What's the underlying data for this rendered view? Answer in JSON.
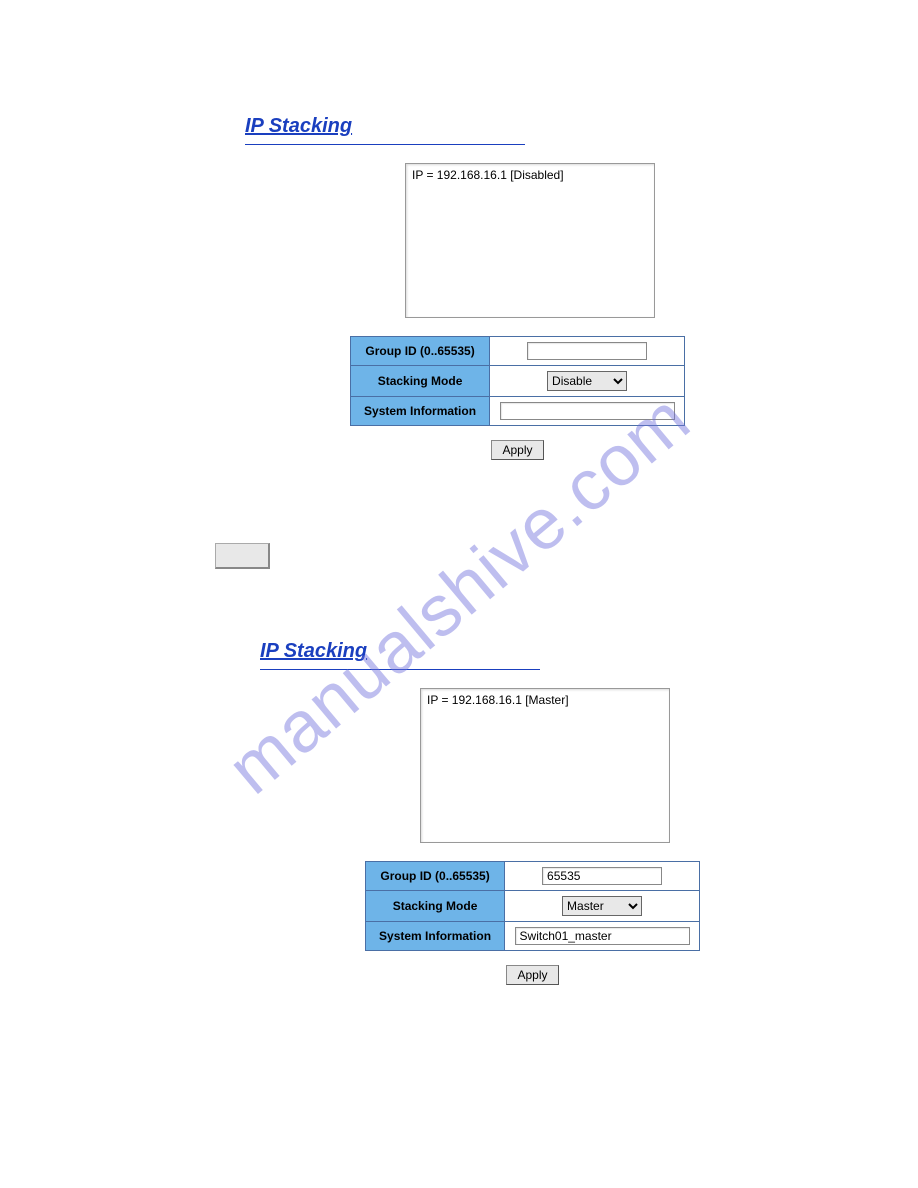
{
  "watermark": "manualshive.com",
  "section1": {
    "title": "IP Stacking",
    "listbox_item": "IP = 192.168.16.1 [Disabled]",
    "group_id_label": "Group ID (0..65535)",
    "group_id_value": "",
    "stacking_mode_label": "Stacking Mode",
    "stacking_mode_value": "Disable",
    "sysinfo_label": "System Information",
    "sysinfo_value": "",
    "apply_label": "Apply"
  },
  "section2": {
    "title": "IP Stacking",
    "listbox_item": "IP = 192.168.16.1 [Master]",
    "group_id_label": "Group ID (0..65535)",
    "group_id_value": "65535",
    "stacking_mode_label": "Stacking Mode",
    "stacking_mode_value": "Master",
    "sysinfo_label": "System Information",
    "sysinfo_value": "Switch01_master",
    "apply_label": "Apply"
  }
}
